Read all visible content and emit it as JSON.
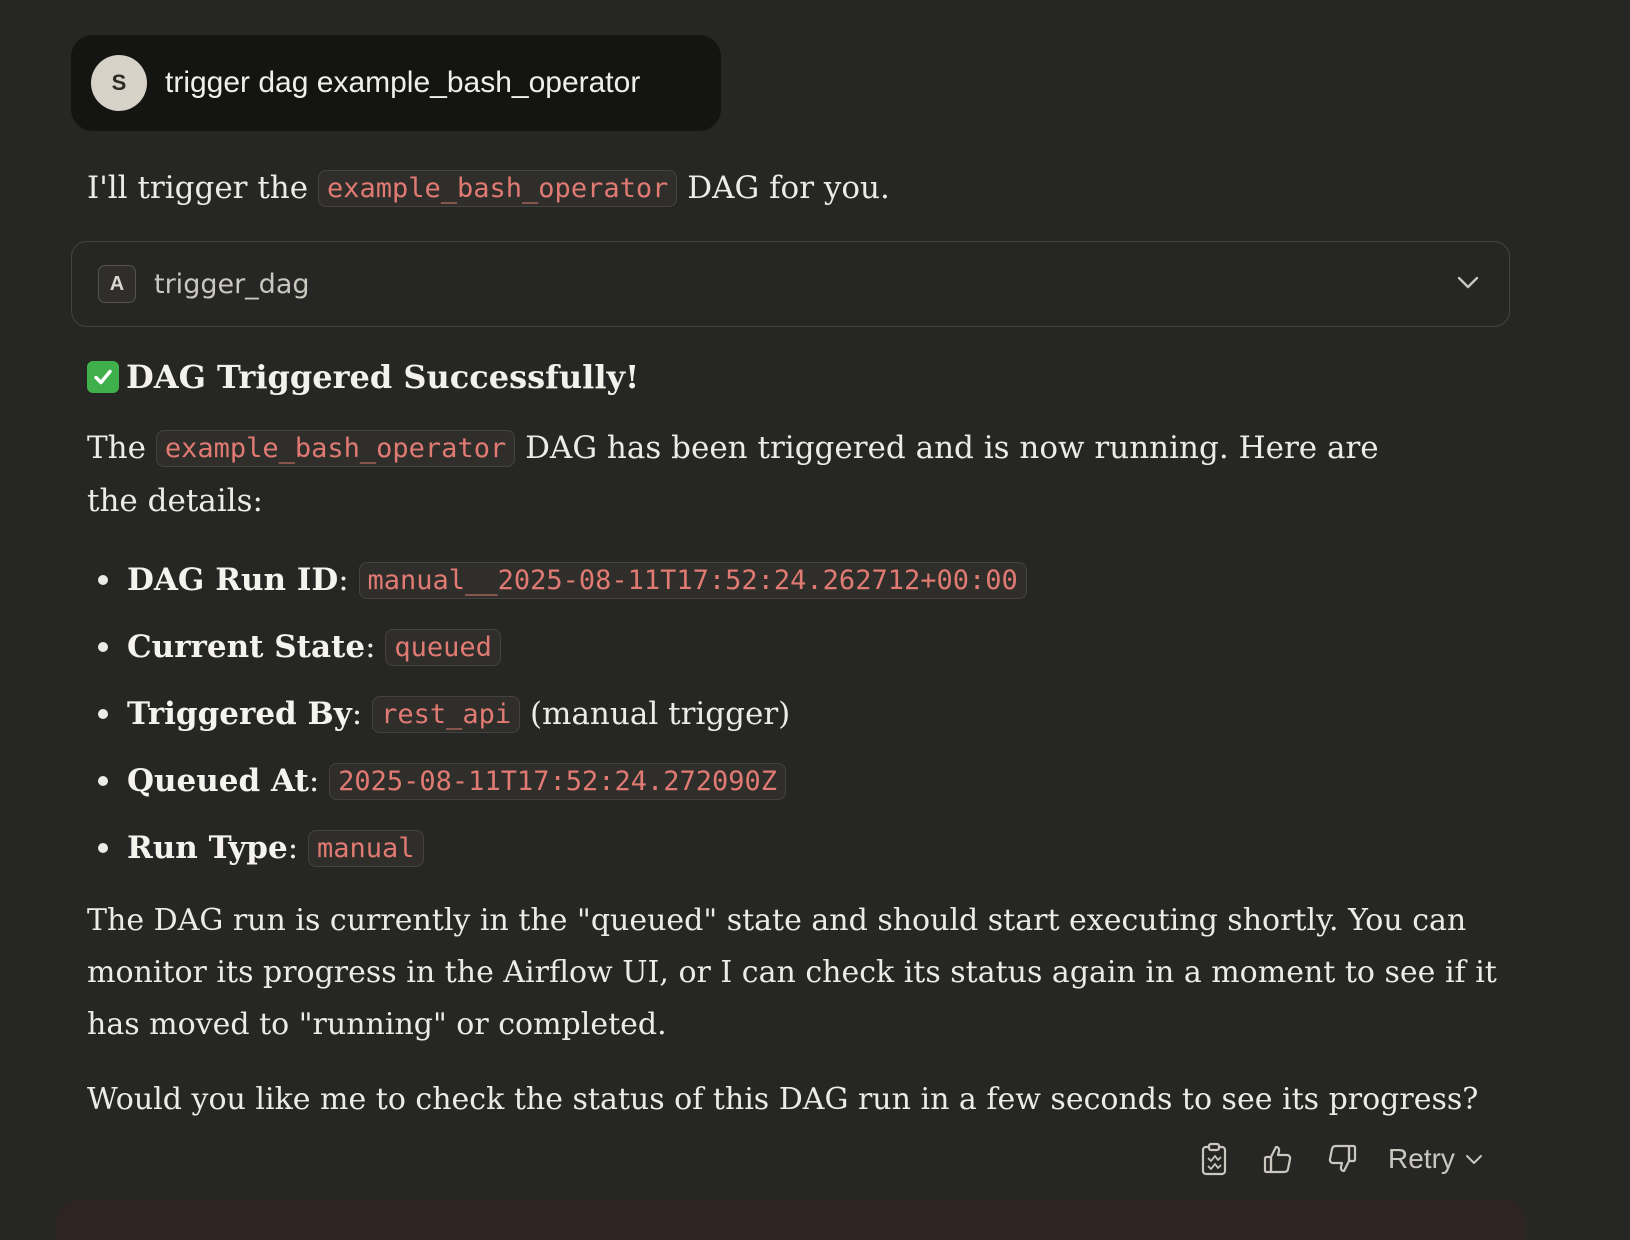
{
  "user_message": {
    "avatar_initial": "S",
    "text": "trigger dag example_bash_operator"
  },
  "assistant": {
    "intro": {
      "before": "I'll trigger the ",
      "code": "example_bash_operator",
      "after": " DAG for you."
    },
    "tool_call": {
      "badge": "A",
      "name": "trigger_dag",
      "icon": "chevron-down-icon"
    },
    "heading": {
      "icon": "check-mark-button-icon",
      "text": "DAG Triggered Successfully!"
    },
    "summary": {
      "before": "The ",
      "code": "example_bash_operator",
      "after": " DAG has been triggered and is now running. Here are the details:"
    },
    "details": [
      {
        "label": "DAG Run ID",
        "value": "manual__2025-08-11T17:52:24.262712+00:00",
        "note": ""
      },
      {
        "label": "Current State",
        "value": "queued",
        "note": ""
      },
      {
        "label": "Triggered By",
        "value": "rest_api",
        "note": " (manual trigger)"
      },
      {
        "label": "Queued At",
        "value": "2025-08-11T17:52:24.272090Z",
        "note": ""
      },
      {
        "label": "Run Type",
        "value": "manual",
        "note": ""
      }
    ],
    "status_paragraph": "The DAG run is currently in the \"queued\" state and should start executing shortly. You can monitor its progress in the Airflow UI, or I can check its status again in a moment to see if it has moved to \"running\" or completed.",
    "question": "Would you like me to check the status of this DAG run in a few seconds to see its progress?"
  },
  "actions": {
    "copy_icon": "clipboard-icon",
    "like_icon": "thumbs-up-icon",
    "dislike_icon": "thumbs-down-icon",
    "retry_label": "Retry"
  },
  "colors": {
    "background": "#262624",
    "code_text": "#e07a72",
    "check_green": "#3fb04b"
  }
}
